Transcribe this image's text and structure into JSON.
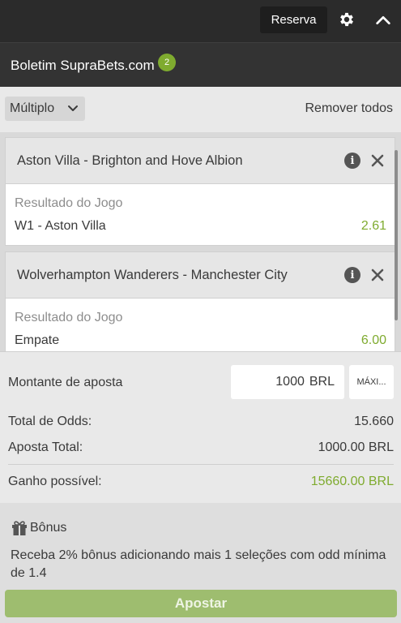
{
  "header": {
    "reserve_label": "Reserva",
    "settings_icon": "gear-icon",
    "collapse_icon": "chevron-up-icon"
  },
  "betslip": {
    "title": "Boletim SupraBets.com",
    "count": "2"
  },
  "toolbar": {
    "bet_type": "Múltiplo",
    "remove_all_label": "Remover todos"
  },
  "selections": [
    {
      "match": "Aston Villa - Brighton and Hove Albion",
      "market": "Resultado do Jogo",
      "pick": "W1 - Aston Villa",
      "odd": "2.61"
    },
    {
      "match": "Wolverhampton Wanderers - Manchester City",
      "market": "Resultado do Jogo",
      "pick": "Empate",
      "odd": "6.00"
    }
  ],
  "summary": {
    "stake_label": "Montante de aposta",
    "stake_value": "1000",
    "stake_currency": "BRL",
    "max_label": "MÁXI...",
    "total_odds_label": "Total de Odds:",
    "total_odds_value": "15.660",
    "total_stake_label": "Aposta Total:",
    "total_stake_value": "1000.00 BRL",
    "possible_win_label": "Ganho possível:",
    "possible_win_value": "15660.00 BRL"
  },
  "bonus": {
    "title": "Bônus",
    "text": "Receba 2% bônus adicionando mais 1 seleções com odd mínima de 1.4",
    "bet_button_label": "Apostar"
  },
  "colors": {
    "accent_green": "#7fab2f",
    "bet_button": "#9ebd6f",
    "header_dark": "#2b2b2b"
  }
}
